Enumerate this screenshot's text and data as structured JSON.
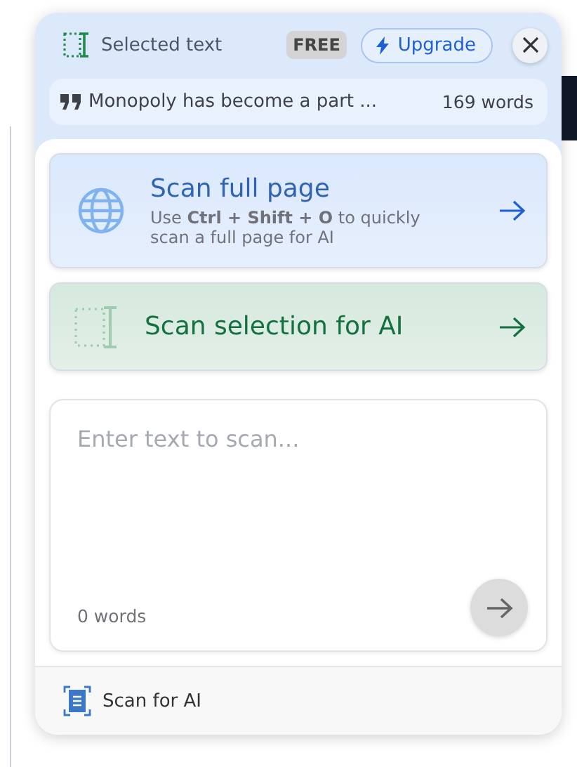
{
  "header": {
    "mode_label": "Selected text",
    "plan_badge": "FREE",
    "upgrade_button": "Upgrade"
  },
  "selection": {
    "quote": "Monopoly has become a part ...",
    "word_count": "169 words"
  },
  "actions": [
    {
      "kind": "page",
      "title": "Scan full page",
      "description": "Use **Ctrl + Shift + O** to quickly scan a full page for AI"
    },
    {
      "kind": "selection",
      "title": "Scan selection for AI"
    }
  ],
  "input": {
    "placeholder": "Enter text to scan...",
    "word_count": "0 words"
  },
  "footer": {
    "label": "Scan for AI"
  }
}
